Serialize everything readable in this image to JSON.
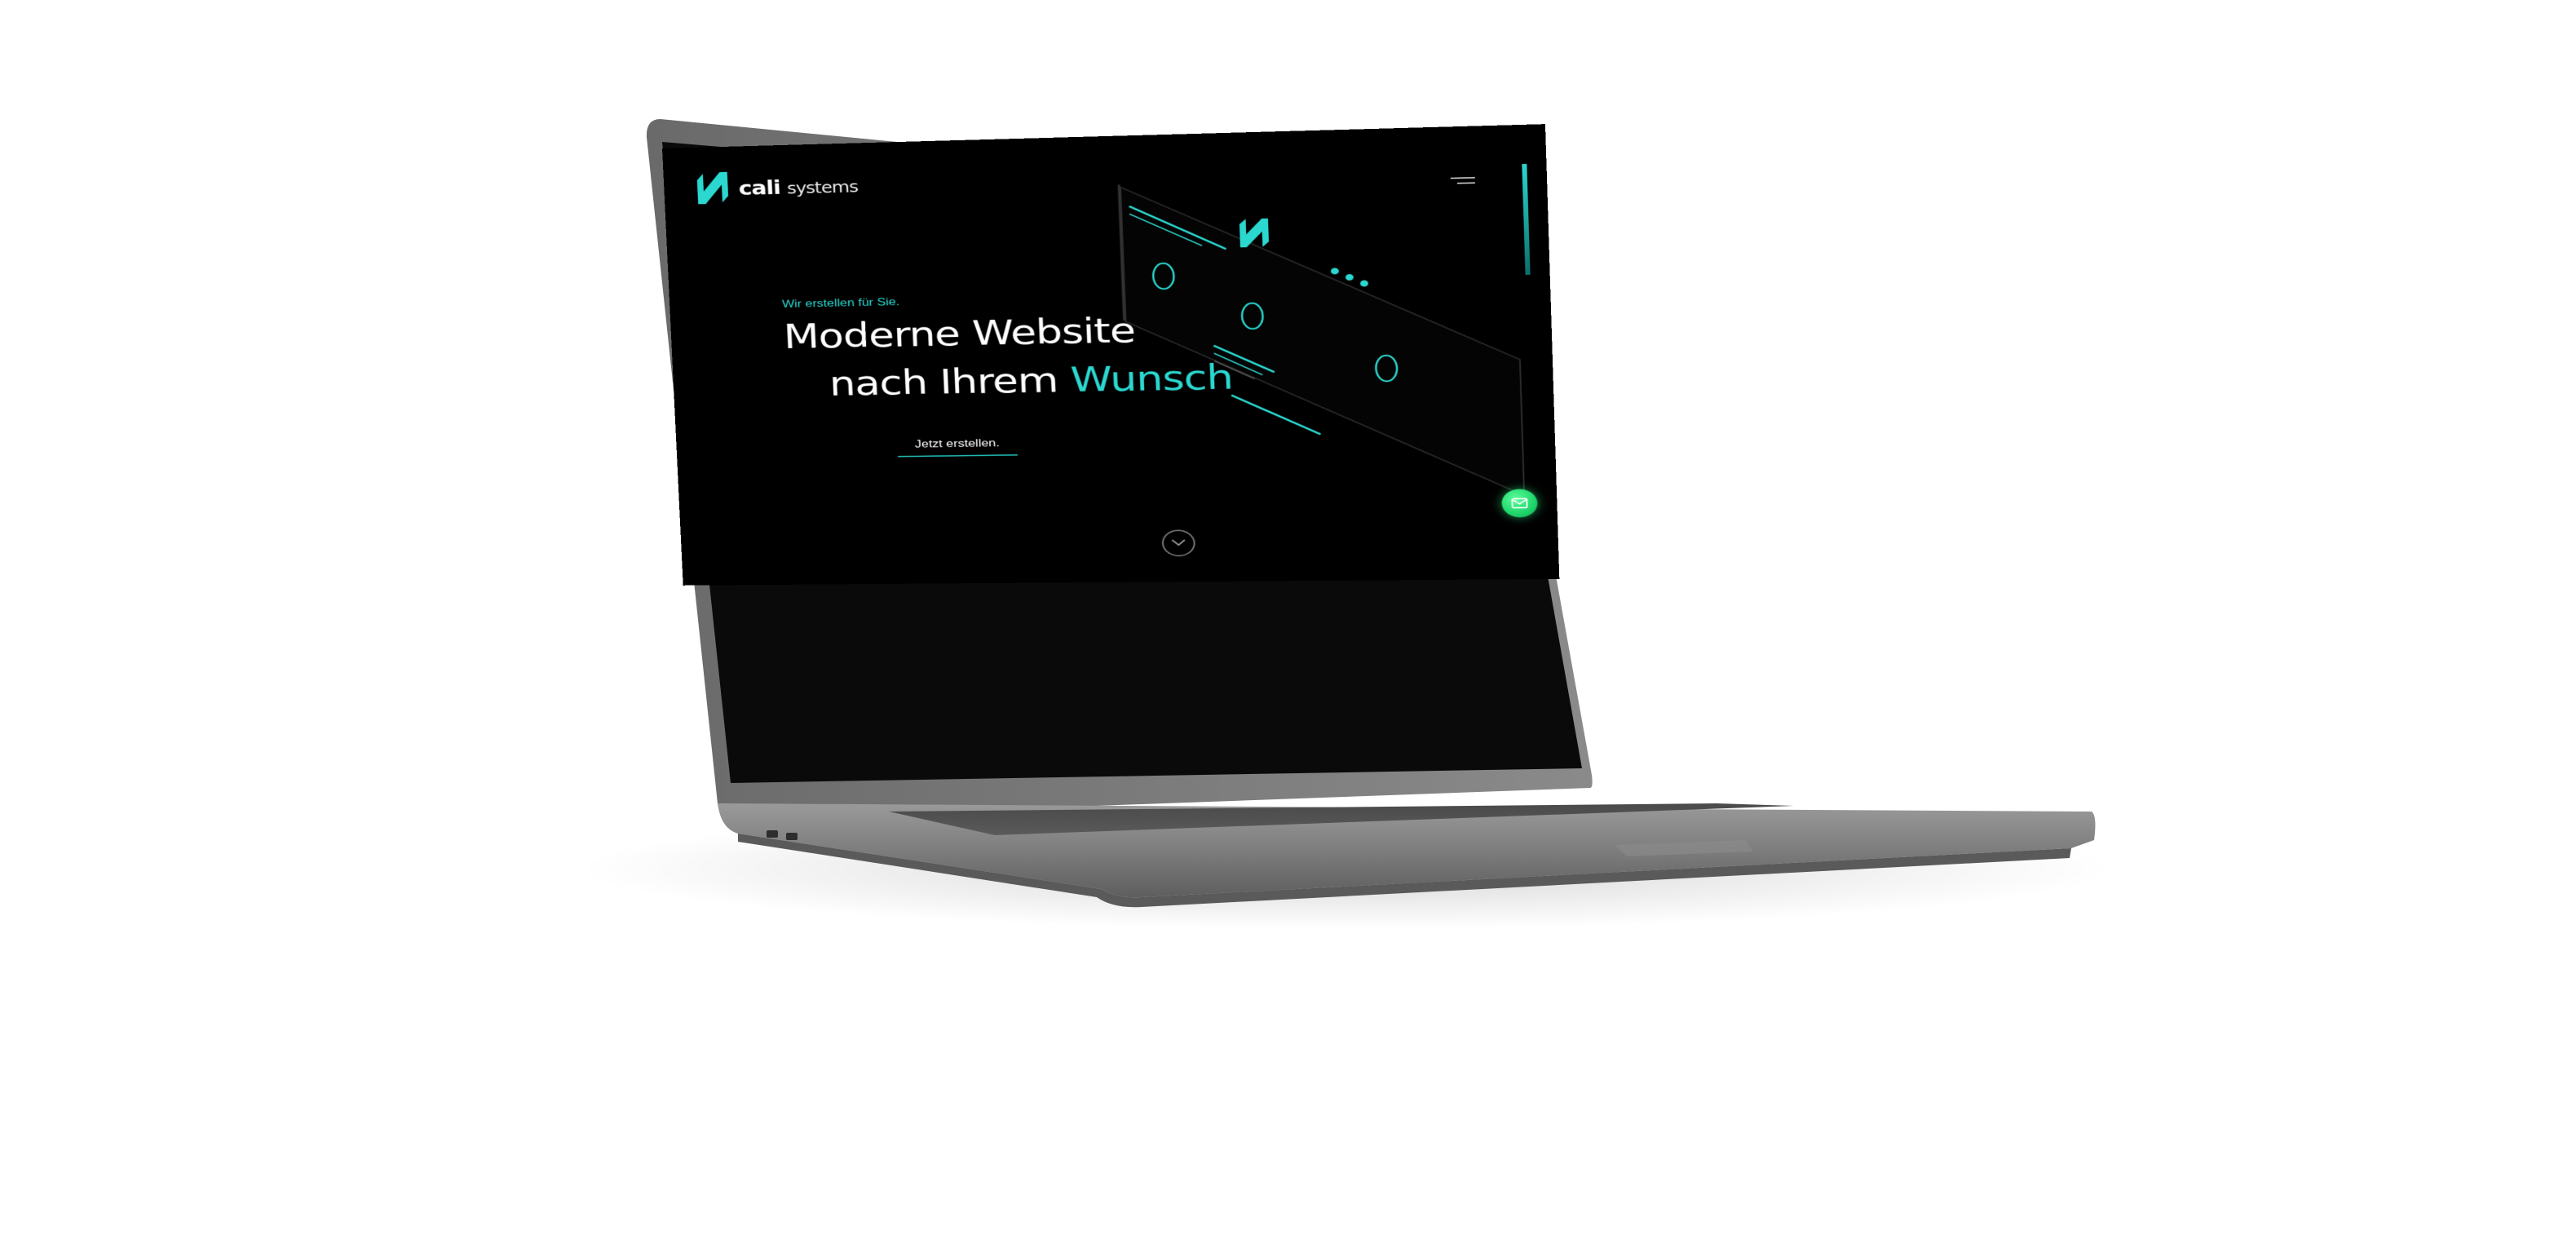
{
  "brand": {
    "name_part1": "cali",
    "name_part2": "systems",
    "logo_icon": "zigzag-n-logo-icon",
    "accent_color": "#2ad8d0"
  },
  "hero": {
    "eyebrow": "Wir erstellen für Sie.",
    "headline_line1": "Moderne Website",
    "headline_line2_plain": "nach Ihrem ",
    "headline_line2_accent": "Wunsch",
    "cta_label": "Jetzt erstellen."
  },
  "controls": {
    "menu_icon": "hamburger-menu-icon",
    "scroll_icon": "chevron-down-icon",
    "contact_icon": "mail-icon",
    "contact_color": "#1ed46a"
  },
  "device": {
    "type": "laptop",
    "body_color": "#7a7a7a"
  }
}
